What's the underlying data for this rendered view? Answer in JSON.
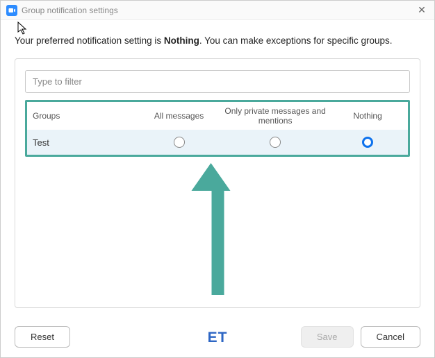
{
  "window": {
    "title": "Group notification settings"
  },
  "description": {
    "prefix": "Your preferred notification setting is ",
    "setting": "Nothing",
    "suffix": ". You can make exceptions for specific groups."
  },
  "filter": {
    "placeholder": "Type to filter"
  },
  "columns": {
    "groups": "Groups",
    "all": "All messages",
    "private": "Only private messages and mentions",
    "nothing": "Nothing"
  },
  "rows": [
    {
      "name": "Test",
      "selected": "nothing"
    }
  ],
  "buttons": {
    "reset": "Reset",
    "save": "Save",
    "cancel": "Cancel"
  },
  "watermark": "ET"
}
